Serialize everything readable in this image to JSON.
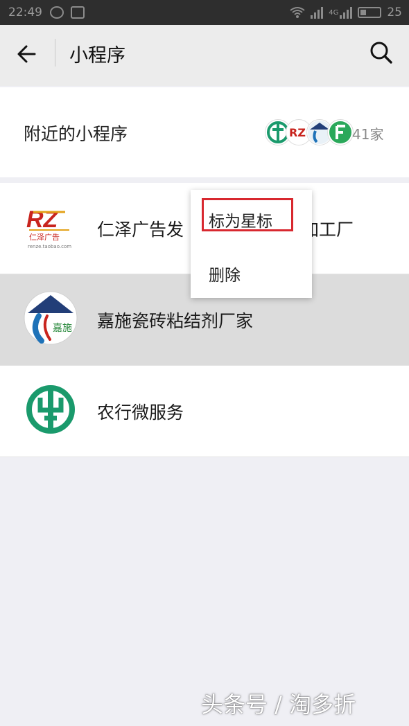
{
  "status_bar": {
    "time": "22:49",
    "network_label": "4G",
    "battery": "25"
  },
  "nav": {
    "title": "小程序",
    "back_icon": "arrow-left-icon",
    "search_icon": "search-icon"
  },
  "nearby": {
    "label": "附近的小程序",
    "count": "41家"
  },
  "items": [
    {
      "name": "仁泽广告发",
      "name_tail": "加工厂",
      "logo_text": "RZ",
      "logo_subtext": "仁泽广告",
      "logo_url_text": "renze.taobao.com"
    },
    {
      "name": "嘉施瓷砖粘结剂厂家",
      "logo_text": "嘉施",
      "pressed": true
    },
    {
      "name": "农行微服务"
    }
  ],
  "context_menu": {
    "star_label": "标为星标",
    "delete_label": "删除"
  },
  "colors": {
    "abc_green": "#1a9a6c",
    "rz_red": "#c8241e",
    "rz_gold": "#e3a21a",
    "jiashi_navy": "#223e78",
    "highlight_red": "#d8282f"
  },
  "watermark": "头条号 / 淘多折"
}
